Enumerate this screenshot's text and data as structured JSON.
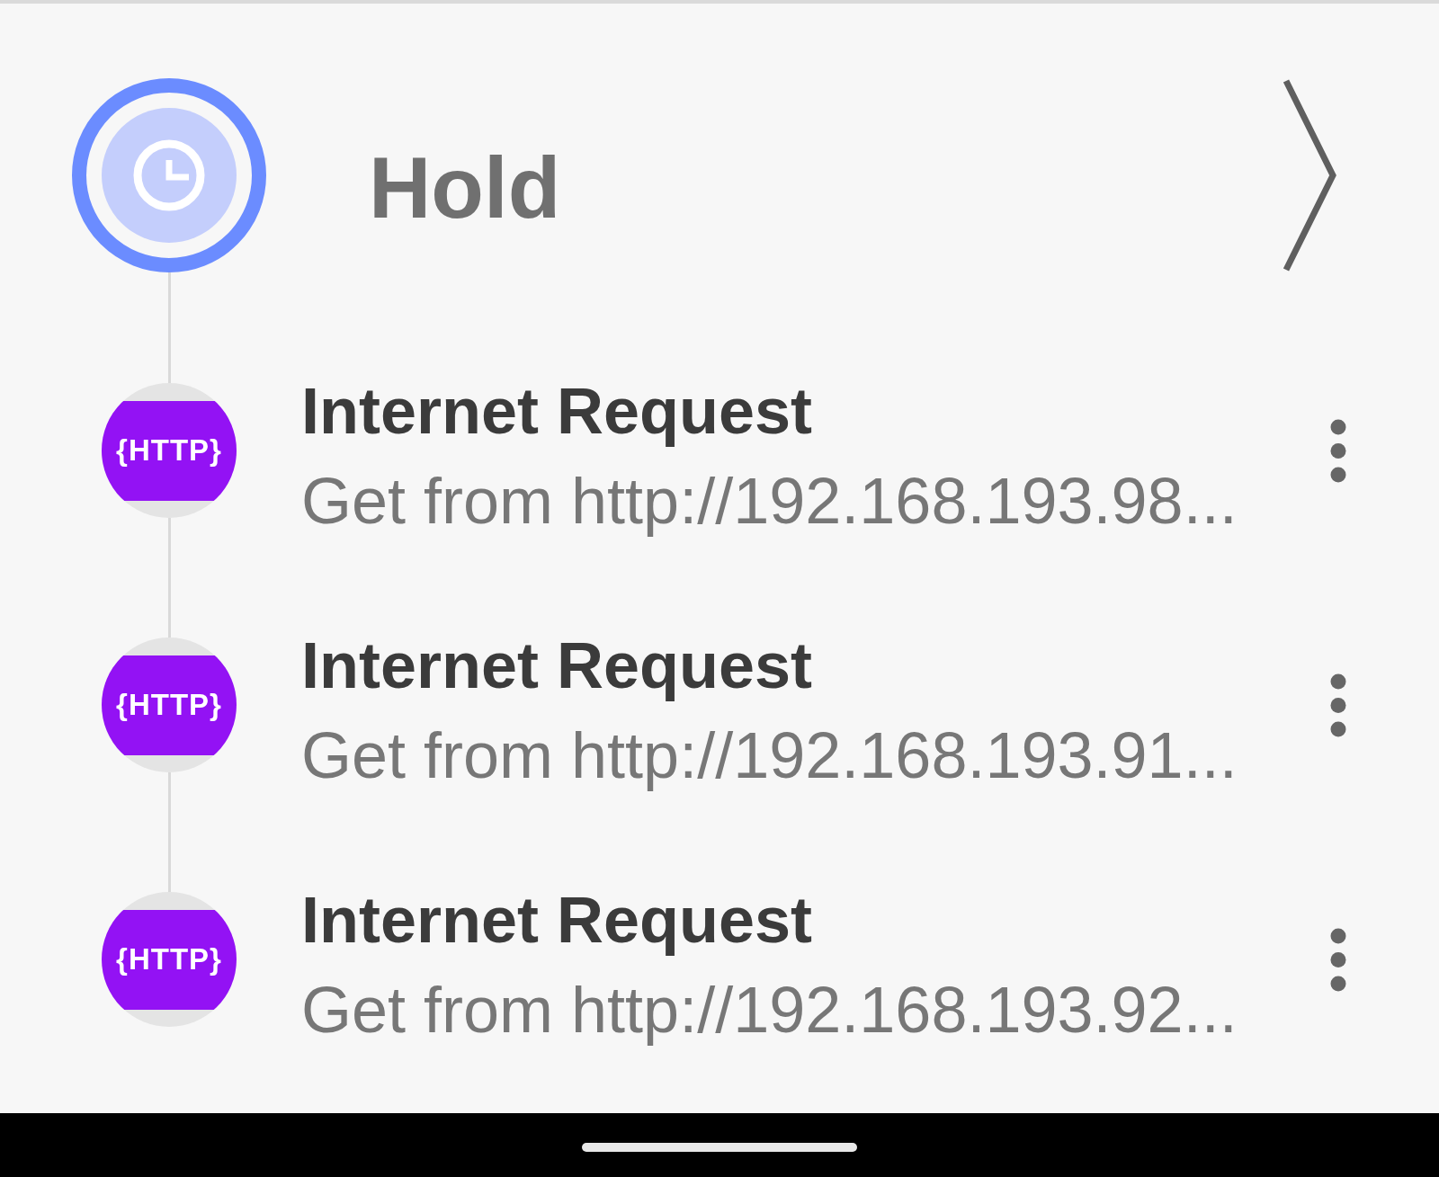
{
  "hold": {
    "title": "Hold"
  },
  "steps": [
    {
      "icon_label": "{HTTP}",
      "title": "Internet Request",
      "subtitle": "Get from http://192.168.193.98..."
    },
    {
      "icon_label": "{HTTP}",
      "title": "Internet Request",
      "subtitle": "Get from http://192.168.193.91..."
    },
    {
      "icon_label": "{HTTP}",
      "title": "Internet Request",
      "subtitle": "Get from http://192.168.193.92..."
    }
  ]
}
